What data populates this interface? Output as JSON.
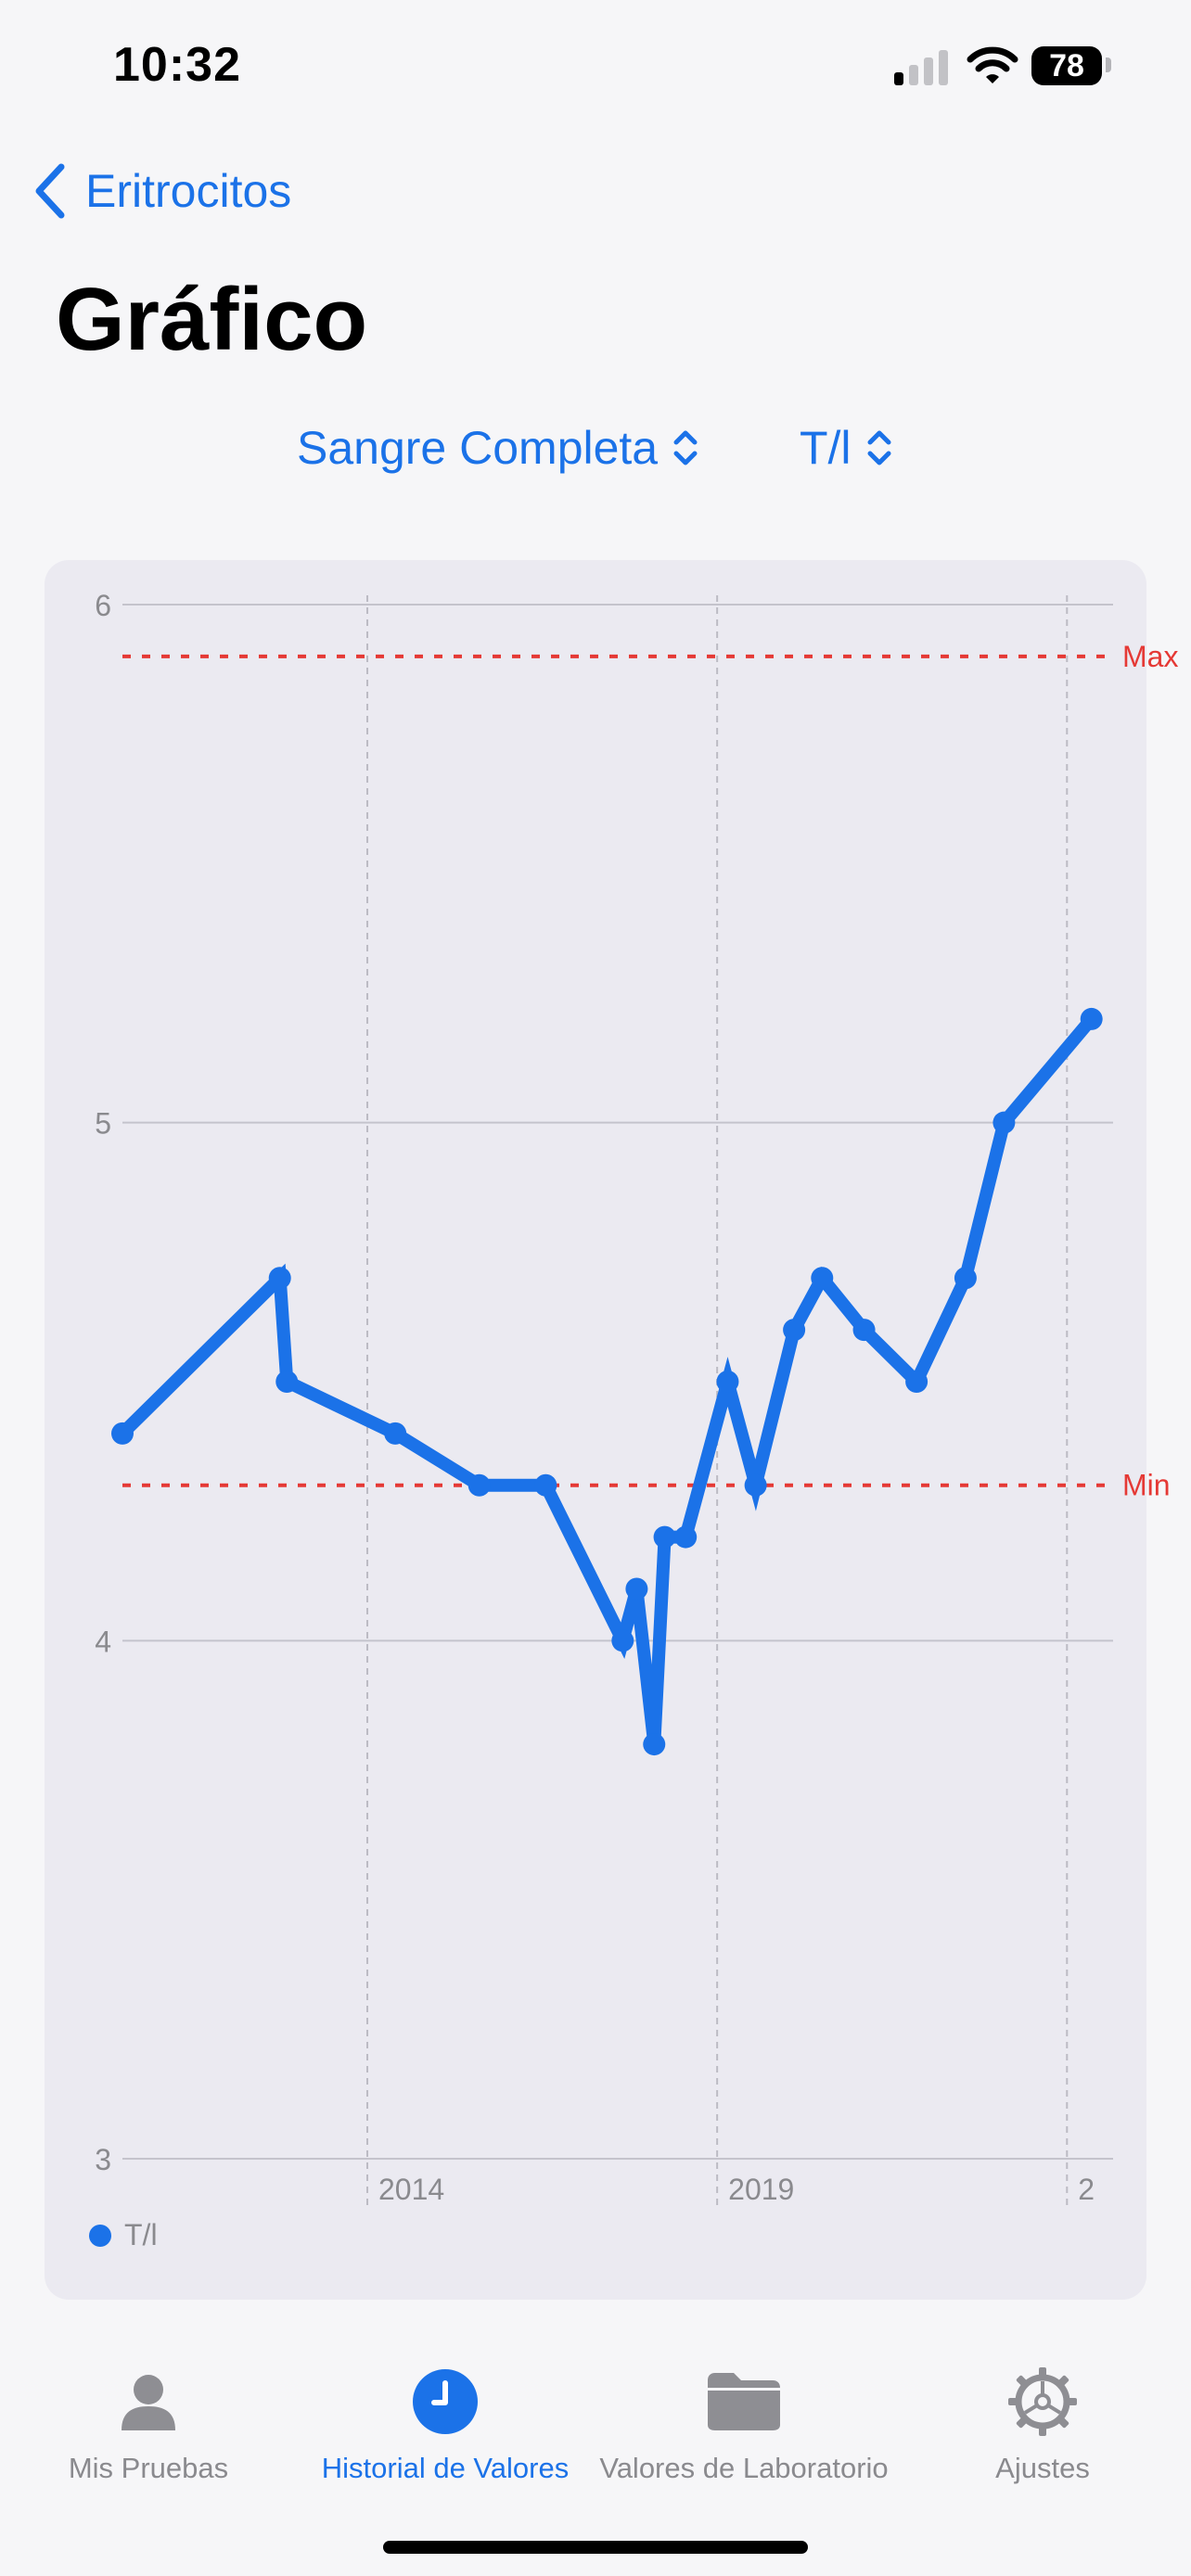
{
  "status_bar": {
    "time": "10:32",
    "battery": "78",
    "icons": [
      "signal-icon",
      "wifi-icon",
      "battery-icon"
    ]
  },
  "nav": {
    "back_label": "Eritrocitos",
    "title": "Gráfico"
  },
  "pickers": {
    "sample_type": "Sangre Completa",
    "unit": "T/l"
  },
  "chart_data": {
    "type": "line",
    "xlabel": "",
    "ylabel": "",
    "ylim": [
      3,
      6
    ],
    "yticks": [
      3,
      4,
      5,
      6
    ],
    "xlim": [
      2010.5,
      2024.5
    ],
    "xticks": [
      {
        "value": 2014,
        "label": "2014"
      },
      {
        "value": 2019,
        "label": "2019"
      },
      {
        "value": 2024,
        "label": "2"
      }
    ],
    "grid": true,
    "reference_lines": [
      {
        "label": "Max",
        "value": 5.9,
        "color": "#e53935"
      },
      {
        "label": "Min",
        "value": 4.3,
        "color": "#e53935"
      }
    ],
    "legend_position": "bottom-left",
    "series": [
      {
        "name": "T/l",
        "color": "#1b72e8",
        "points": [
          {
            "x": 2010.5,
            "y": 4.4
          },
          {
            "x": 2012.75,
            "y": 4.7
          },
          {
            "x": 2012.85,
            "y": 4.5
          },
          {
            "x": 2014.4,
            "y": 4.4
          },
          {
            "x": 2015.6,
            "y": 4.3
          },
          {
            "x": 2016.55,
            "y": 4.3
          },
          {
            "x": 2017.65,
            "y": 4.0
          },
          {
            "x": 2017.85,
            "y": 4.1
          },
          {
            "x": 2018.1,
            "y": 3.8
          },
          {
            "x": 2018.25,
            "y": 4.2
          },
          {
            "x": 2018.55,
            "y": 4.2
          },
          {
            "x": 2019.15,
            "y": 4.5
          },
          {
            "x": 2019.55,
            "y": 4.3
          },
          {
            "x": 2020.1,
            "y": 4.6
          },
          {
            "x": 2020.5,
            "y": 4.7
          },
          {
            "x": 2021.1,
            "y": 4.6
          },
          {
            "x": 2021.85,
            "y": 4.5
          },
          {
            "x": 2022.55,
            "y": 4.7
          },
          {
            "x": 2023.1,
            "y": 5.0
          },
          {
            "x": 2024.35,
            "y": 5.2
          }
        ]
      }
    ]
  },
  "legend": {
    "label": "T/l"
  },
  "tab_bar": {
    "tabs": [
      {
        "label": "Mis Pruebas",
        "icon": "person-icon",
        "active": false
      },
      {
        "label": "Historial de Valores",
        "icon": "clock-icon",
        "active": true
      },
      {
        "label": "Valores de Laboratorio",
        "icon": "folder-icon",
        "active": false
      },
      {
        "label": "Ajustes",
        "icon": "gear-icon",
        "active": false
      }
    ]
  }
}
